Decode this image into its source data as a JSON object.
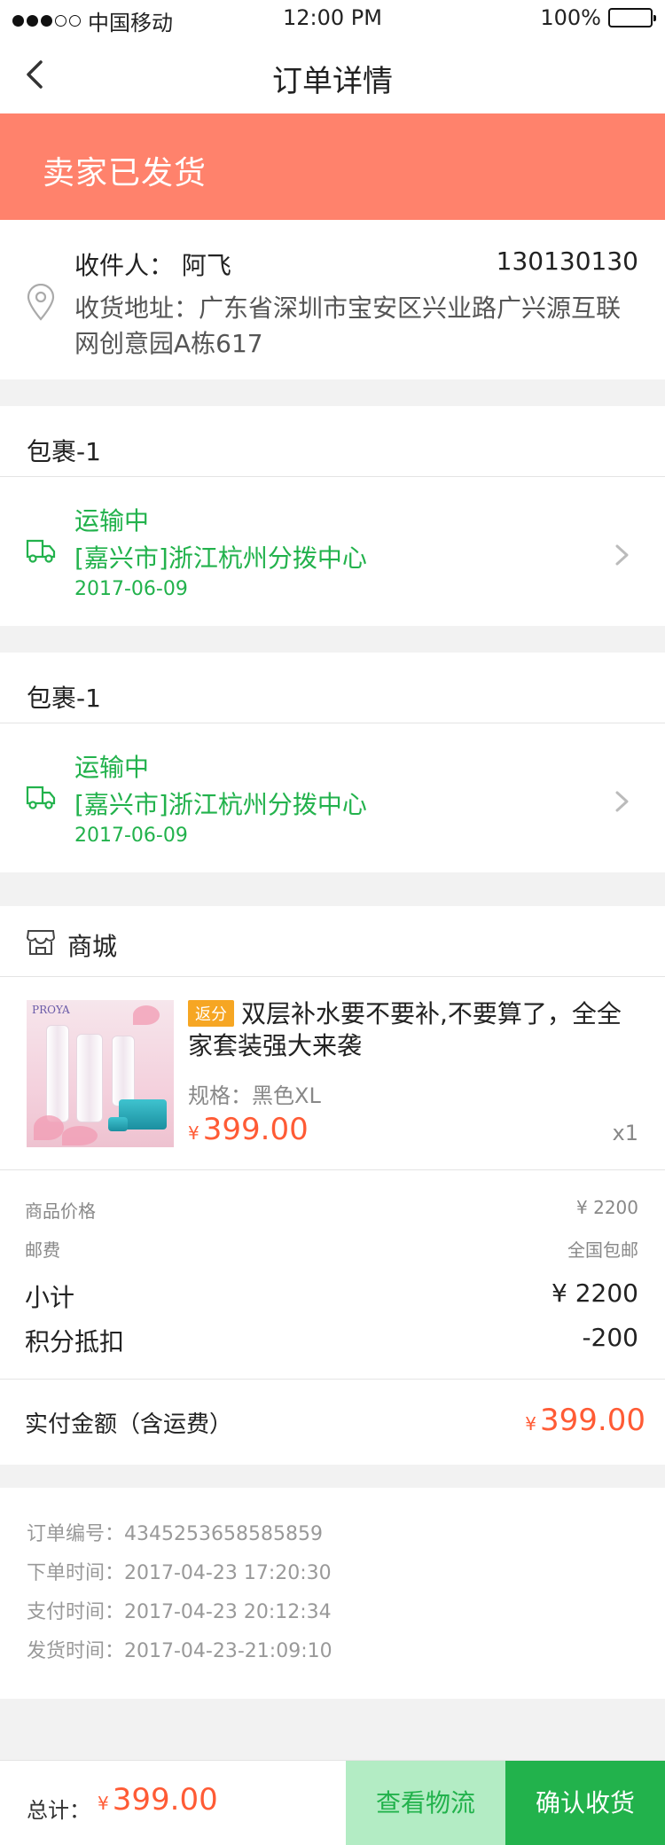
{
  "status_bar": {
    "carrier": "中国移动",
    "time": "12:00 PM",
    "battery": "100%"
  },
  "nav": {
    "title": "订单详情"
  },
  "banner": {
    "status": "卖家已发货"
  },
  "address": {
    "recipient": "收件人：  阿飞",
    "phone": "130130130",
    "address_line": "收货地址：广东省深圳市宝安区兴业路广兴源互联网创意园A栋617"
  },
  "packages": [
    {
      "name": "包裹-1",
      "status": "运输中",
      "location": "[嘉兴市]浙江杭州分拨中心",
      "date": "2017-06-09"
    },
    {
      "name": "包裹-1",
      "status": "运输中",
      "location": "[嘉兴市]浙江杭州分拨中心",
      "date": "2017-06-09"
    }
  ],
  "shop": {
    "name": "商城",
    "item": {
      "badge": "返分",
      "brand": "PROYA",
      "title": "双层补水要不要补,不要算了，全全家套装强大来袭",
      "spec": "规格：黑色XL",
      "currency": "¥",
      "price": "399.00",
      "qty": "x1"
    },
    "fees": {
      "goods_label": "商品价格",
      "goods_value": "¥ 2200",
      "shipping_label": "邮费",
      "shipping_value": "全国包邮",
      "subtotal_label": "小计",
      "subtotal_value": "¥ 2200",
      "points_label": "积分抵扣",
      "points_value": "-200"
    },
    "total": {
      "label": "实付金额（含运费）",
      "currency": "¥",
      "value": "399.00"
    }
  },
  "order_info": {
    "order_no": "订单编号：4345253658585859",
    "order_time": "下单时间：2017-04-23 17:20:30",
    "pay_time": "支付时间：2017-04-23 20:12:34",
    "ship_time": "发货时间：2017-04-23-21:09:10"
  },
  "bottom_bar": {
    "total_label": "总计：",
    "currency": "¥",
    "total_value": "399.00",
    "track_button": "查看物流",
    "confirm_button": "确认收货"
  },
  "colors": {
    "banner": "#ff826c",
    "accent_green": "#22b24c",
    "price_red": "#ff5b35",
    "badge_orange": "#f6a623"
  }
}
